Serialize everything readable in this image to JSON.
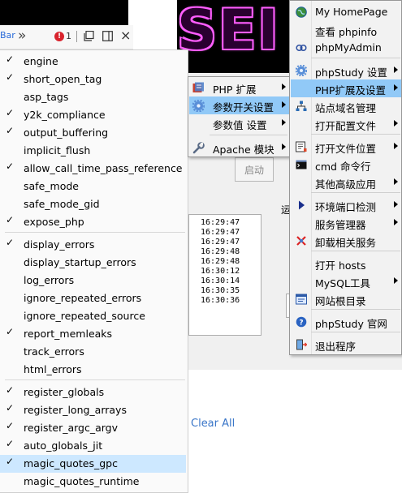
{
  "toolbar": {
    "tab_fragment": "Bar",
    "chevrons": "»",
    "alert_badge": "!",
    "alert_count": "1",
    "close": "×"
  },
  "background": {
    "start_button": "启动",
    "running_label": "运",
    "log_times": [
      "16:29:47",
      "16:29:47",
      "16:29:47",
      "16:29:48",
      "16:29:48",
      "16:30:12",
      "16:30:14",
      "16:30:35",
      "16:30:36"
    ],
    "clear_all": "Clear All"
  },
  "php_settings_menu": {
    "items": [
      {
        "label": "engine",
        "checked": true
      },
      {
        "label": "short_open_tag",
        "checked": true
      },
      {
        "label": "asp_tags",
        "checked": false
      },
      {
        "label": "y2k_compliance",
        "checked": true
      },
      {
        "label": "output_buffering",
        "checked": true
      },
      {
        "label": "implicit_flush",
        "checked": false
      },
      {
        "label": "allow_call_time_pass_reference",
        "checked": true
      },
      {
        "label": "safe_mode",
        "checked": false
      },
      {
        "label": "safe_mode_gid",
        "checked": false
      },
      {
        "label": "expose_php",
        "checked": true
      },
      {
        "label": "display_errors",
        "checked": true
      },
      {
        "label": "display_startup_errors",
        "checked": false
      },
      {
        "label": "log_errors",
        "checked": false
      },
      {
        "label": "ignore_repeated_errors",
        "checked": false
      },
      {
        "label": "ignore_repeated_source",
        "checked": false
      },
      {
        "label": "report_memleaks",
        "checked": true
      },
      {
        "label": "track_errors",
        "checked": false
      },
      {
        "label": "html_errors",
        "checked": false
      },
      {
        "label": "register_globals",
        "checked": true
      },
      {
        "label": "register_long_arrays",
        "checked": true
      },
      {
        "label": "register_argc_argv",
        "checked": true
      },
      {
        "label": "auto_globals_jit",
        "checked": true
      },
      {
        "label": "magic_quotes_gpc",
        "checked": true,
        "selected": true
      },
      {
        "label": "magic_quotes_runtime",
        "checked": false
      }
    ]
  },
  "php_ext_submenu": {
    "items": [
      {
        "label": "PHP 扩展",
        "icon": "php-extension-icon",
        "arrow": true
      },
      {
        "label": "参数开关设置",
        "icon": "gear-icon",
        "arrow": true,
        "highlighted": true
      },
      {
        "label": "参数值 设置",
        "icon": "",
        "arrow": true
      },
      {
        "label": "Apache 模块",
        "icon": "wrench-icon",
        "arrow": true
      }
    ]
  },
  "tray_menu": {
    "items": [
      {
        "label": "My HomePage",
        "icon": "globe-icon"
      },
      {
        "label": "查看 phpinfo",
        "icon": ""
      },
      {
        "label": "phpMyAdmin",
        "icon": "link-icon"
      },
      {
        "label": "phpStudy 设置",
        "icon": "gear-icon",
        "arrow": true
      },
      {
        "label": "PHP扩展及设置",
        "icon": "",
        "arrow": true,
        "highlighted": true
      },
      {
        "label": "站点域名管理",
        "icon": "sitemap-icon"
      },
      {
        "label": "打开配置文件",
        "icon": "",
        "arrow": true
      },
      {
        "label": "打开文件位置",
        "icon": "folder-icon",
        "arrow": true
      },
      {
        "label": "cmd 命令行",
        "icon": "terminal-icon"
      },
      {
        "label": "其他高级应用",
        "icon": "",
        "arrow": true
      },
      {
        "label": "环境端口检测",
        "icon": "play-icon",
        "arrow": true
      },
      {
        "label": "服务管理器",
        "icon": "",
        "arrow": true
      },
      {
        "label": "卸载相关服务",
        "icon": "uninstall-icon"
      },
      {
        "label": "打开 hosts",
        "icon": ""
      },
      {
        "label": "MySQL工具",
        "icon": "",
        "arrow": true
      },
      {
        "label": "网站根目录",
        "icon": "web-folder-icon"
      },
      {
        "label": "phpStudy 官网",
        "icon": "info-icon"
      },
      {
        "label": "退出程序",
        "icon": "exit-icon"
      }
    ]
  }
}
